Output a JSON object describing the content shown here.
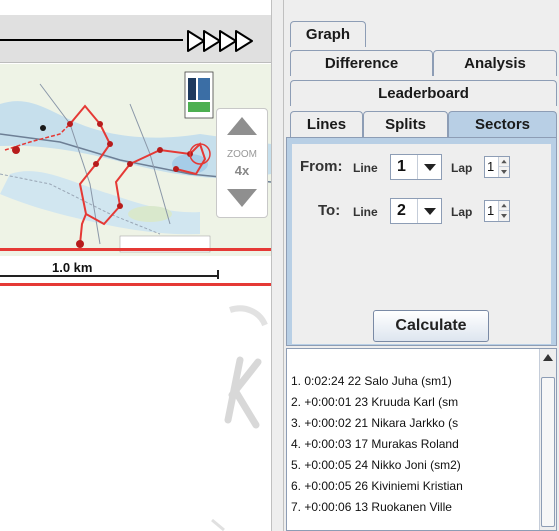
{
  "map": {
    "zoom_label": "ZOOM",
    "zoom_value": "4x",
    "scale_text": "1.0 km"
  },
  "tabs": {
    "graph": "Graph",
    "difference": "Difference",
    "analysis": "Analysis",
    "leaderboard": "Leaderboard",
    "lines": "Lines",
    "splits": "Splits",
    "sectors": "Sectors",
    "selected": "Sectors"
  },
  "sectors": {
    "from_label": "From:",
    "to_label": "To:",
    "line_label": "Line",
    "lap_label": "Lap",
    "from_line": "1",
    "from_lap": "1",
    "to_line": "2",
    "to_lap": "1",
    "calculate_label": "Calculate"
  },
  "results": [
    "1. 0:02:24 22 Salo Juha (sm1)",
    "2. +0:00:01 23 Kruuda Karl (sm",
    "3. +0:00:02 21 Nikara Jarkko (s",
    "4. +0:00:03 17 Murakas Roland",
    "5. +0:00:05 24 Nikko Joni (sm2)",
    "6. +0:00:05 26 Kiviniemi Kristian",
    "7. +0:00:06 13 Ruokanen Ville"
  ],
  "colors": {
    "tab_selected": "#b8cfe5",
    "route_red": "#e53935",
    "border": "#8d9db5"
  }
}
